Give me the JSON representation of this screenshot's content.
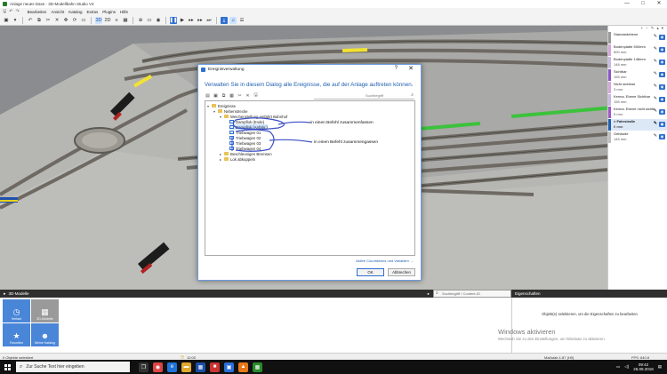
{
  "window": {
    "title": "Anlage neues Dase - 3D-Modellbahn Studio V4",
    "minimize": "—",
    "maximize": "□",
    "close": "✕"
  },
  "menu": {
    "items": [
      "Bearbeiten",
      "Ansicht",
      "Katalog",
      "Extras",
      "Plugins",
      "Hilfe"
    ]
  },
  "toolbar": {
    "btn_3d": "3D",
    "btn_2d": "2D"
  },
  "layers": {
    "items": [
      {
        "name": "Standardebene",
        "sub": ""
      },
      {
        "name": "Bodenplatte 500mm",
        "sub": "500 mm"
      },
      {
        "name": "Bodenplatte 148mm",
        "sub": "148 mm"
      },
      {
        "name": "Sichtbar",
        "sub": "155 mm"
      },
      {
        "name": "Nicht sichtbar",
        "sub": "3 mm"
      },
      {
        "name": "Kenna. Ebene Sichtbar",
        "sub": "155 mm"
      },
      {
        "name": "Kenna. Ebene nicht sichtb.",
        "sub": "5 mm"
      },
      {
        "name": "> Fahrstraße",
        "sub": "0 mm"
      },
      {
        "name": "Gebäude",
        "sub": "145 mm"
      }
    ],
    "colors": [
      "#9a9a9a",
      "#d3a7d8",
      "#c7b9e0",
      "#8a56c6",
      "#d3a7d8",
      "#c7b9e0",
      "#9e58c9",
      "#1f5fb0",
      "#bfbfbf"
    ]
  },
  "models_panel": {
    "header": "3D-Modelle",
    "tiles": [
      {
        "label": "Verlauf",
        "icon": "clock-icon",
        "glyph": "◷"
      },
      {
        "label": "3D-Modelle",
        "icon": "grid-icon",
        "glyph": "▦"
      },
      {
        "label": "Favoriten",
        "icon": "star-icon",
        "glyph": "★"
      },
      {
        "label": "Meine Katalog",
        "icon": "people-icon",
        "glyph": "☻"
      }
    ]
  },
  "search": {
    "placeholder": "Suchbegriff / Content-ID"
  },
  "properties": {
    "header": "Eigenschaften",
    "message": "Objekt(e) selektieren, um die Eigenschaften zu bearbeiten",
    "watermark_title": "Windows aktivieren",
    "watermark_sub": "Wechseln Sie zu den Einstellungen, um Windows zu aktivieren."
  },
  "status": {
    "left": "0 Objekte selektiert",
    "time": "12:00",
    "scale": "Maßstab 1:87 (H0)",
    "fps": "FPS: 640.8"
  },
  "taskbar": {
    "search_placeholder": "Zur Suche Text hier eingeben",
    "time": "09:42",
    "date": "26.09.2018"
  },
  "dialog": {
    "title": "Ereignisverwaltung",
    "help": "?",
    "close": "✕",
    "heading": "Verwalten Sie in diesem Dialog alle Ereignisse, die auf der Anlage auftreten können.",
    "search_placeholder": "Suchbegriff",
    "tree": [
      {
        "label": "Ereignisse",
        "type": "folder"
      },
      {
        "label": "Nebenstrecke",
        "type": "folder"
      },
      {
        "label": "Weichenstellung einfahrt Bahnhof",
        "type": "folder"
      },
      {
        "label": "Dampflok (Ende)",
        "type": "event"
      },
      {
        "label": "Dampflok (Anfahr.)",
        "type": "event"
      },
      {
        "label": "Triebwagen 01",
        "type": "event"
      },
      {
        "label": "Triebwagen 02",
        "type": "event"
      },
      {
        "label": "Triebwagen 03",
        "type": "event"
      },
      {
        "label": "Triebwagen 04",
        "type": "event"
      },
      {
        "label": "Beschleunigen Bremsen",
        "type": "folder"
      },
      {
        "label": "Lok abkuppeln",
        "type": "folder"
      }
    ],
    "annotation1": "in einen Befehl zusammenfassen",
    "annotation2": "in einen Befehl zusammengassen",
    "link": "Aktive Countdowns und Variablen →",
    "ok": "OK",
    "cancel": "Abbrechen"
  }
}
